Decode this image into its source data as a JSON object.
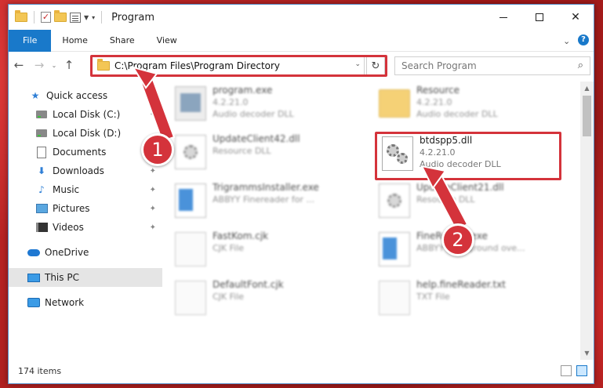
{
  "window": {
    "title": "Program",
    "minimize_glyph": "",
    "close_glyph": "✕"
  },
  "ribbon": {
    "tabs": [
      {
        "label": "File"
      },
      {
        "label": "Home"
      },
      {
        "label": "Share"
      },
      {
        "label": "View"
      }
    ],
    "collapse_glyph": "⌃",
    "help_glyph": "?"
  },
  "nav": {
    "back": "←",
    "forward": "→",
    "history": "⌄",
    "up": "↑",
    "address": "C:\\Program Files\\Program Directory",
    "refresh": "↻",
    "search_placeholder": "Search Program",
    "search_icon": "⌕"
  },
  "sidebar": {
    "items": [
      {
        "label": "Quick access",
        "icon": "star-icon"
      },
      {
        "label": "Local Disk (C:)",
        "icon": "disk-icon",
        "pinned": true
      },
      {
        "label": "Local Disk (D:)",
        "icon": "disk-icon"
      },
      {
        "label": "Documents",
        "icon": "documents-icon",
        "pinned": true
      },
      {
        "label": "Downloads",
        "icon": "download-icon",
        "pinned": true
      },
      {
        "label": "Music",
        "icon": "music-icon",
        "pinned": true
      },
      {
        "label": "Pictures",
        "icon": "pictures-icon",
        "pinned": true
      },
      {
        "label": "Videos",
        "icon": "videos-icon",
        "pinned": true
      },
      {
        "label": "OneDrive",
        "icon": "onedrive-icon"
      },
      {
        "label": "This PC",
        "icon": "this-pc-icon"
      },
      {
        "label": "Network",
        "icon": "network-icon"
      }
    ],
    "pin_glyph": "📌"
  },
  "files": [
    {
      "name": "program.exe",
      "version": "4.2.21.0",
      "desc": "Audio decoder DLL"
    },
    {
      "name": "Resource",
      "version": "4.2.21.0",
      "desc": "Audio decoder DLL"
    },
    {
      "name": "UpdateClient42.dll",
      "version": "",
      "desc": "Resource DLL"
    },
    {
      "name": "btdspp5.dll",
      "version": "4.2.21.0",
      "desc": "Audio decoder DLL"
    },
    {
      "name": "TrigrammsInstaller.exe",
      "version": "",
      "desc": "ABBYY Finereader for ..."
    },
    {
      "name": "UpdateClient21.dll",
      "version": "",
      "desc": "Resource DLL"
    },
    {
      "name": "FastKom.cjk",
      "version": "",
      "desc": "CJK File"
    },
    {
      "name": "FineReader.exe",
      "version": "",
      "desc": "ABBYY Background ove..."
    },
    {
      "name": "DefaultFont.cjk",
      "version": "",
      "desc": "CJK File"
    },
    {
      "name": "help.fineReader.txt",
      "version": "",
      "desc": "TXT File"
    }
  ],
  "status": {
    "count": "174 items"
  },
  "annotations": {
    "badge1": "1",
    "badge2": "2"
  },
  "colors": {
    "accent": "#1979ca",
    "highlight": "#d4333b"
  }
}
